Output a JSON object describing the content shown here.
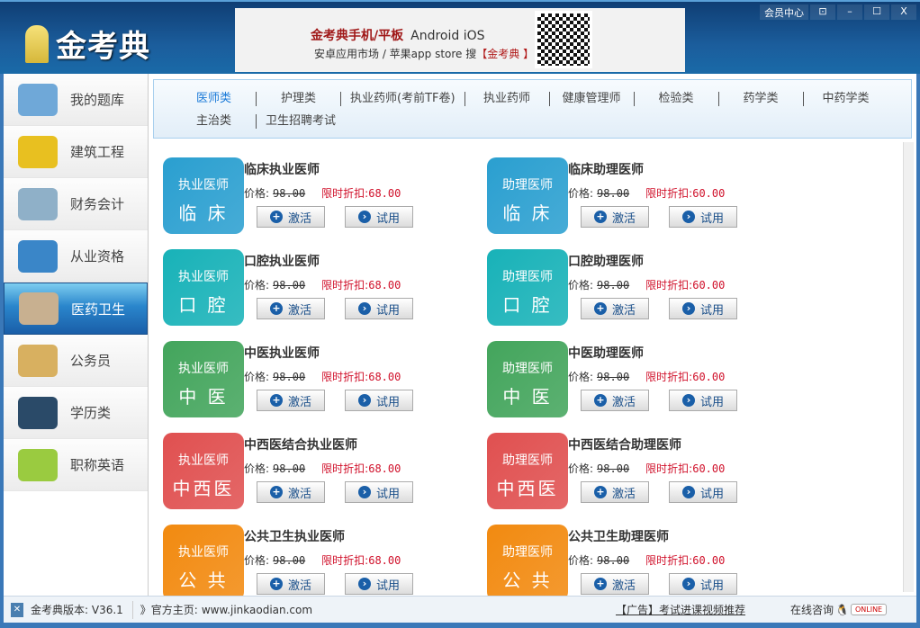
{
  "header": {
    "logo": "金考典",
    "banner_line1": "金考典手机/平板",
    "banner_os": "Android  iOS",
    "banner_line2_prefix": "安卓应用市场 / 苹果app store 搜",
    "banner_line2_brand": "【金考典 】",
    "member_center": "会员中心",
    "pin": "⊡",
    "minimize": "–",
    "maximize": "☐",
    "close": "X"
  },
  "sidebar": {
    "items": [
      {
        "label": "我的题库",
        "color": "#6fa8d8"
      },
      {
        "label": "建筑工程",
        "color": "#e8c020"
      },
      {
        "label": "财务会计",
        "color": "#8fb0c8"
      },
      {
        "label": "从业资格",
        "color": "#3a86c8"
      },
      {
        "label": "医药卫生",
        "color": "#c8b090"
      },
      {
        "label": "公务员",
        "color": "#d8b060"
      },
      {
        "label": "学历类",
        "color": "#2a4a68"
      },
      {
        "label": "职称英语",
        "color": "#9acb40"
      }
    ],
    "active": 4
  },
  "tabs": {
    "row1": [
      "医师类",
      "护理类",
      "执业药师(考前TF卷)",
      "执业药师",
      "健康管理师",
      "检验类",
      "药学类",
      "中药学类"
    ],
    "row2": [
      "主治类",
      "卫生招聘考试"
    ],
    "active": "医师类"
  },
  "cards": [
    {
      "tag": "执业医师",
      "short": "临 床",
      "title": "临床执业医师",
      "old": "98.00",
      "new": "68.00",
      "color": "#2a9fd0"
    },
    {
      "tag": "助理医师",
      "short": "临 床",
      "title": "临床助理医师",
      "old": "98.00",
      "new": "60.00",
      "color": "#2a9fd0"
    },
    {
      "tag": "执业医师",
      "short": "口 腔",
      "title": "口腔执业医师",
      "old": "98.00",
      "new": "68.00",
      "color": "#18b2b8"
    },
    {
      "tag": "助理医师",
      "short": "口 腔",
      "title": "口腔助理医师",
      "old": "98.00",
      "new": "60.00",
      "color": "#18b2b8"
    },
    {
      "tag": "执业医师",
      "short": "中 医",
      "title": "中医执业医师",
      "old": "98.00",
      "new": "68.00",
      "color": "#43a55c"
    },
    {
      "tag": "助理医师",
      "short": "中 医",
      "title": "中医助理医师",
      "old": "98.00",
      "new": "60.00",
      "color": "#43a55c"
    },
    {
      "tag": "执业医师",
      "short": "中西医",
      "title": "中西医结合执业医师",
      "old": "98.00",
      "new": "68.00",
      "color": "#e05050"
    },
    {
      "tag": "助理医师",
      "short": "中西医",
      "title": "中西医结合助理医师",
      "old": "98.00",
      "new": "60.00",
      "color": "#e05050"
    },
    {
      "tag": "执业医师",
      "short": "公 共",
      "title": "公共卫生执业医师",
      "old": "98.00",
      "new": "68.00",
      "color": "#f28a10"
    },
    {
      "tag": "助理医师",
      "short": "公 共",
      "title": "公共卫生助理医师",
      "old": "98.00",
      "new": "60.00",
      "color": "#f28a10"
    }
  ],
  "labels": {
    "price": "价格:",
    "discount": "限时折扣:",
    "activate": "激活",
    "trial": "试用",
    "activate_icon": "+",
    "trial_icon": "›"
  },
  "footer": {
    "version": "金考典版本: V36.1",
    "home_prefix": "》官方主页:",
    "home_url": "www.jinkaodian.com",
    "ad": "【广告】考试进课视频推荐",
    "consult": "在线咨询",
    "online": "ONLINE"
  }
}
